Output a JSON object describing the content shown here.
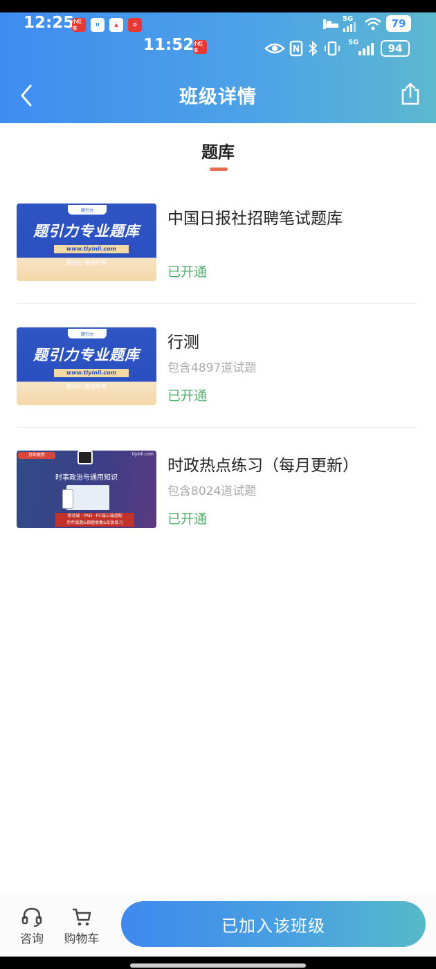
{
  "status_bar": {
    "time_outer": "12:25",
    "time_inner": "11:52",
    "battery_outer": "79",
    "battery_inner": "94",
    "net_outer": "5G",
    "net_inner": "5G"
  },
  "header": {
    "title": "班级详情",
    "back_icon": "chevron-left-icon",
    "share_icon": "share-icon",
    "gradient_start": "#3f8cf0",
    "gradient_end": "#5db8cf"
  },
  "section": {
    "tab_label": "题库",
    "underline_color": "#e36f4e"
  },
  "banks": [
    {
      "name": "中国日报社招聘笔试题库",
      "count": "",
      "status": "已开通",
      "thumb": {
        "main": "题引力专业题库",
        "url": "www.tiyinli.com",
        "copy": "题引力 版权所有"
      }
    },
    {
      "name": "行测",
      "count": "包含4897道试题",
      "status": "已开通",
      "thumb": {
        "main": "题引力专业题库",
        "url": "www.tiyinli.com",
        "copy": "题引力 版权所有"
      }
    },
    {
      "name": "时政热点练习（每月更新）",
      "count": "包含8024道试题",
      "status": "已开通",
      "thumb": {
        "tag": "持续更新",
        "site": "tiyinli.com",
        "title": "时事政治与通用知识",
        "bar_line1": "移动端 · PAD · PC端三端适配",
        "bar_line2": "历年真题&错题收集&反复练习"
      }
    }
  ],
  "status_color": "#4cae6a",
  "bottom": {
    "consult_label": "咨询",
    "cart_label": "购物车",
    "join_label": "已加入该班级"
  }
}
